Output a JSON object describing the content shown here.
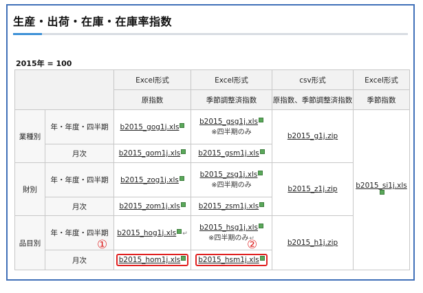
{
  "page": {
    "title": "生産・出荷・在庫・在庫率指数",
    "base_year": "2015年 = 100"
  },
  "columns": [
    {
      "format": "Excel形式",
      "desc": "原指数"
    },
    {
      "format": "Excel形式",
      "desc": "季節調整済指数"
    },
    {
      "format": "csv形式",
      "desc": "原指数、季節調整済指数"
    },
    {
      "format": "Excel形式",
      "desc": "季節指数"
    }
  ],
  "groups": [
    {
      "label": "業種別",
      "rows": [
        {
          "period": "年・年度・四半期",
          "orig": "b2015_gog1j.xls",
          "sa": "b2015_gsg1j.xls",
          "sa_note": "※四半期のみ"
        },
        {
          "period": "月次",
          "orig": "b2015_gom1j.xls",
          "sa": "b2015_gsm1j.xls"
        }
      ],
      "csv": "b2015_g1j.zip"
    },
    {
      "label": "財別",
      "rows": [
        {
          "period": "年・年度・四半期",
          "orig": "b2015_zog1j.xls",
          "sa": "b2015_zsg1j.xls",
          "sa_note": "※四半期のみ"
        },
        {
          "period": "月次",
          "orig": "b2015_zom1j.xls",
          "sa": "b2015_zsm1j.xls"
        }
      ],
      "csv": "b2015_z1j.zip"
    },
    {
      "label": "品目別",
      "rows": [
        {
          "period": "年・年度・四半期",
          "orig": "b2015_hog1j.xls",
          "sa": "b2015_hsg1j.xls",
          "sa_note": "※四半期のみ"
        },
        {
          "period": "月次",
          "orig": "b2015_hom1j.xls",
          "sa": "b2015_hsm1j.xls"
        }
      ],
      "csv": "b2015_h1j.zip"
    }
  ],
  "seasonal": "b2015_si1j.xls",
  "markers": {
    "one": "①",
    "two": "②"
  },
  "colors": {
    "frame": "#3f6fb8",
    "accent": "#3a8fd6",
    "highlight": "#e02020",
    "marker": "#dd2222"
  }
}
